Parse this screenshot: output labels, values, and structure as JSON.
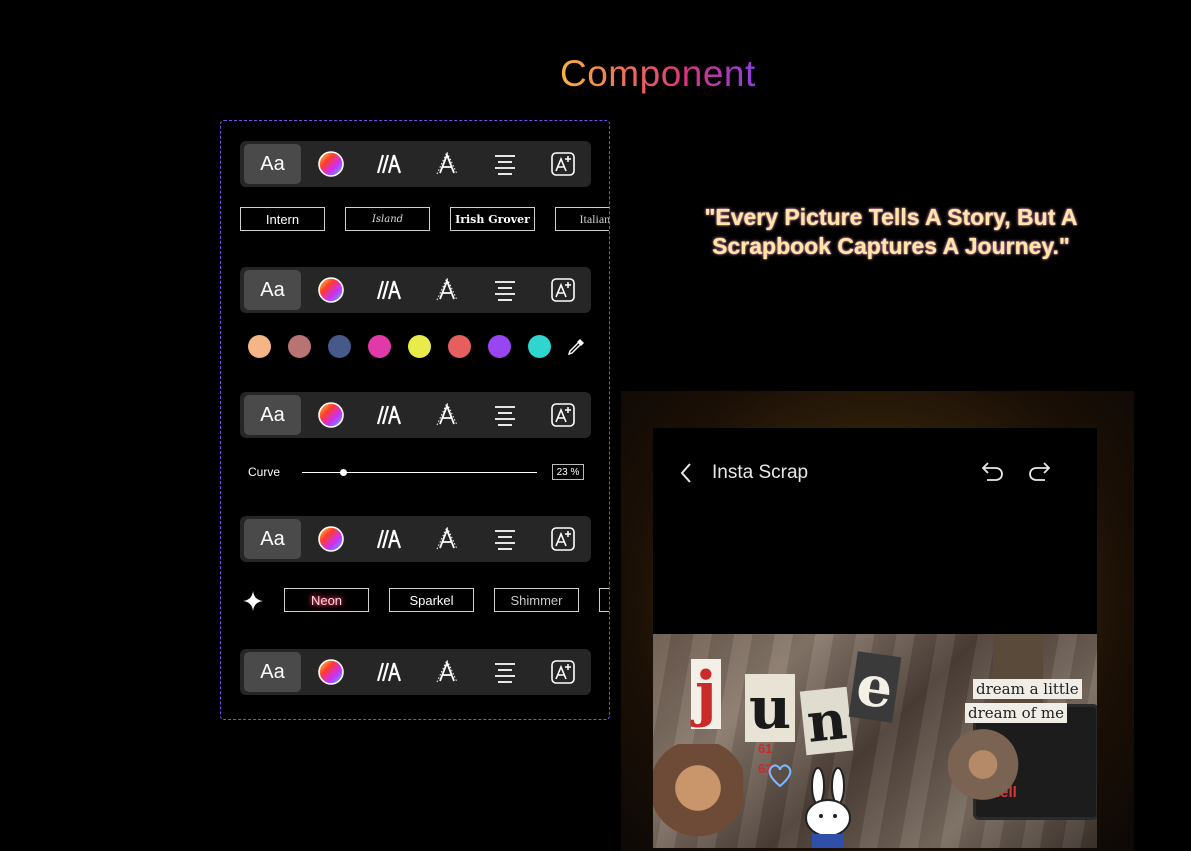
{
  "page": {
    "title": "Component"
  },
  "toolbar": {
    "font_label": "Aa",
    "buttons": [
      "font-button",
      "color-button",
      "spacing-button",
      "outline-button",
      "align-button",
      "effects-button"
    ]
  },
  "fonts": [
    "Intern",
    "Island",
    "Irish Grover",
    "Italiana"
  ],
  "colors": [
    "#f5b586",
    "#b87474",
    "#455a8a",
    "#e03aa9",
    "#e8ec4a",
    "#e55f5f",
    "#9a45f2",
    "#2fd6cf"
  ],
  "curve": {
    "label": "Curve",
    "value_text": "23 %",
    "value": 0.23
  },
  "effects": [
    "Neon",
    "Sparkel",
    "Shimmer"
  ],
  "quote": {
    "text": "\"Every Picture Tells A Story, But A Scrapbook Captures A Journey.\""
  },
  "app": {
    "title": "Insta Scrap"
  },
  "collage": {
    "letters": [
      "j",
      "u",
      "n",
      "e"
    ],
    "caption_line1": "dream a little",
    "caption_line2": "dream of me",
    "numbers": "61\n63",
    "sticker": "hell"
  }
}
